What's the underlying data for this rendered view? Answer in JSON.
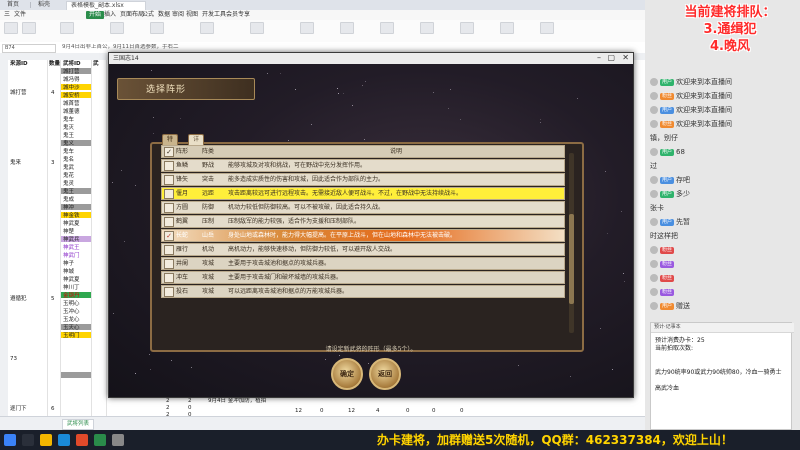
{
  "window": {
    "tabs": [
      "首页",
      "稻壳",
      "表格模板_副本.xlsx"
    ],
    "menus": [
      "三",
      "文件",
      "开始",
      "插入",
      "页面布局",
      "公式",
      "数据",
      "审阅",
      "视图",
      "开发工具",
      "会员专享"
    ],
    "name_box": "B74",
    "formula_text": "9月4日出非上首公，9月11日首选参数，手右二"
  },
  "sheet": {
    "col_headers": [
      "来源ID",
      "数量",
      "武将ID",
      "武"
    ],
    "group_labels": [
      {
        "id": "g1",
        "text": "城打营"
      },
      {
        "id": "g2",
        "text": "鬼来"
      },
      {
        "id": "g3",
        "text": "遵循犯"
      },
      {
        "id": "g4",
        "text": "73"
      },
      {
        "id": "g5",
        "text": "逐门下"
      }
    ],
    "count_cells": [
      "4",
      "3",
      "5",
      "6"
    ],
    "names": [
      "城打营",
      "城冯得",
      "城中沙",
      "城安桥",
      "城首营",
      "城董德",
      "鬼车",
      "鬼灭",
      "鬼王",
      "鬼义",
      "鬼车",
      "鬼名",
      "鬼武",
      "鬼花",
      "鬼灵",
      "鬼王",
      "鬼成",
      "神冲",
      "神金铁",
      "神武夏",
      "神楚",
      "神武兵",
      "神武王",
      "神武门",
      "神子",
      "神城",
      "神武夏",
      "神川丁",
      "金钢丹",
      "玉明心",
      "玉冲心",
      "玉龙心",
      "玉天心",
      "玉明门"
    ],
    "bottom_rows": [
      [
        "2",
        "2",
        "9月4日 金冲加防，植拍"
      ],
      [
        "2",
        "0",
        ""
      ],
      [
        "2",
        "0",
        ""
      ]
    ],
    "bottom_numbers": [
      "12",
      "0",
      "12",
      "4",
      "0",
      "0",
      "0"
    ],
    "sheet_tab": "武将列表"
  },
  "game": {
    "window_title": "三国志14",
    "header": "选择阵形",
    "tabs": {
      "active": "特征",
      "inactive": "详情"
    },
    "table_headers": {
      "c1": "阵形",
      "c2": "阵类",
      "c3": "说明"
    },
    "rows": [
      {
        "c1": "鱼鳞",
        "c2": "野战",
        "c3": "能够攻城及对攻和挑战，可在野战中充分发挥作用。",
        "style": "normal",
        "checked": false
      },
      {
        "c1": "锋矢",
        "c2": "突击",
        "c3": "能多造成实质性的伤害和攻城，因此适合作为部队的主力。",
        "style": "normal",
        "checked": false
      },
      {
        "c1": "偃月",
        "c2": "远距",
        "c3": "攻击距离较远可进行远程攻击。无需接近敌人便可战斗。不过，在野战中无法持续战斗。",
        "style": "yellow",
        "checked": false
      },
      {
        "c1": "方圆",
        "c2": "防御",
        "c3": "机动力较低但防御较高。可以不被攻破，因此适合持久战。",
        "style": "normal",
        "checked": false
      },
      {
        "c1": "鹤翼",
        "c2": "压制",
        "c3": "压制敌军的能力较强，适合作为支援和压制部队。",
        "style": "normal",
        "checked": false
      },
      {
        "c1": "长蛇",
        "c2": "山岳",
        "c3": "身处山地或森林时，能力得大幅提高。在平原上战斗，但在山地和森林中无法被击破。",
        "style": "orange",
        "checked": true
      },
      {
        "c1": "雁行",
        "c2": "机动",
        "c3": "高机动力，能够快速移动，但防御力较低，可以避开敌人交战。",
        "style": "normal",
        "checked": false
      },
      {
        "c1": "井阑",
        "c2": "攻城",
        "c3": "主要用于攻击城池和据点的攻城兵器。",
        "style": "dim",
        "checked": false
      },
      {
        "c1": "冲车",
        "c2": "攻城",
        "c3": "主要用于攻击城门和破坏城墙的攻城兵器。",
        "style": "dim",
        "checked": false
      },
      {
        "c1": "投石",
        "c2": "攻城",
        "c3": "可以远距离攻击城池和据点的万能攻城兵器。",
        "style": "dim",
        "checked": false
      }
    ],
    "hint": "请设定新武将的阵形（最多5个）。",
    "buttons": {
      "confirm": "确定",
      "back": "返回"
    }
  },
  "stream": {
    "queue_title": "当前建将排队：",
    "queue_items": [
      "3.通缉犯",
      "4.晚风"
    ],
    "chat": [
      {
        "badge": "用户",
        "badge_color": "green",
        "text": "欢迎来到本直播间"
      },
      {
        "badge": "粉丝",
        "badge_color": "orange",
        "text": "欢迎来到本直播间"
      },
      {
        "badge": "用户",
        "badge_color": "blue",
        "text": "欢迎来到本直播间"
      },
      {
        "badge": "粉丝",
        "badge_color": "orange",
        "text": "欢迎来到本直播间"
      },
      {
        "badge": "",
        "badge_color": "",
        "text": "镇，别仔"
      },
      {
        "badge": "用户",
        "badge_color": "green",
        "text": "68"
      },
      {
        "badge": "",
        "badge_color": "",
        "text": "过"
      },
      {
        "badge": "用户",
        "badge_color": "blue",
        "text": "存吧"
      },
      {
        "badge": "用户",
        "badge_color": "green",
        "text": "多少"
      },
      {
        "badge": "",
        "badge_color": "",
        "text": "张卡"
      },
      {
        "badge": "用户",
        "badge_color": "blue",
        "text": "先暂"
      },
      {
        "badge": "",
        "badge_color": "",
        "text": "时这样把"
      },
      {
        "badge": "粉丝",
        "badge_color": "red",
        "text": ""
      },
      {
        "badge": "粉丝",
        "badge_color": "purple",
        "text": ""
      },
      {
        "badge": "粉丝",
        "badge_color": "red",
        "text": ""
      },
      {
        "badge": "粉丝",
        "badge_color": "purple",
        "text": ""
      },
      {
        "badge": "用户",
        "badge_color": "orange",
        "text": "赠送"
      }
    ],
    "notepad": {
      "title": "预计·记事本",
      "lines": [
        "预计消费办卡：25",
        "当前拍取次数:",
        "",
        "武力90统率90或武力90统帅80，冷血一骑勇士",
        "高武冷血"
      ]
    },
    "bottom_banner": "办卡建将，加群赠送5次随机，QQ群：462337384，欢迎上山！",
    "taskbar_time": "",
    "colors": {
      "queue": "#ff2a2a",
      "banner": "#ffd400"
    }
  }
}
